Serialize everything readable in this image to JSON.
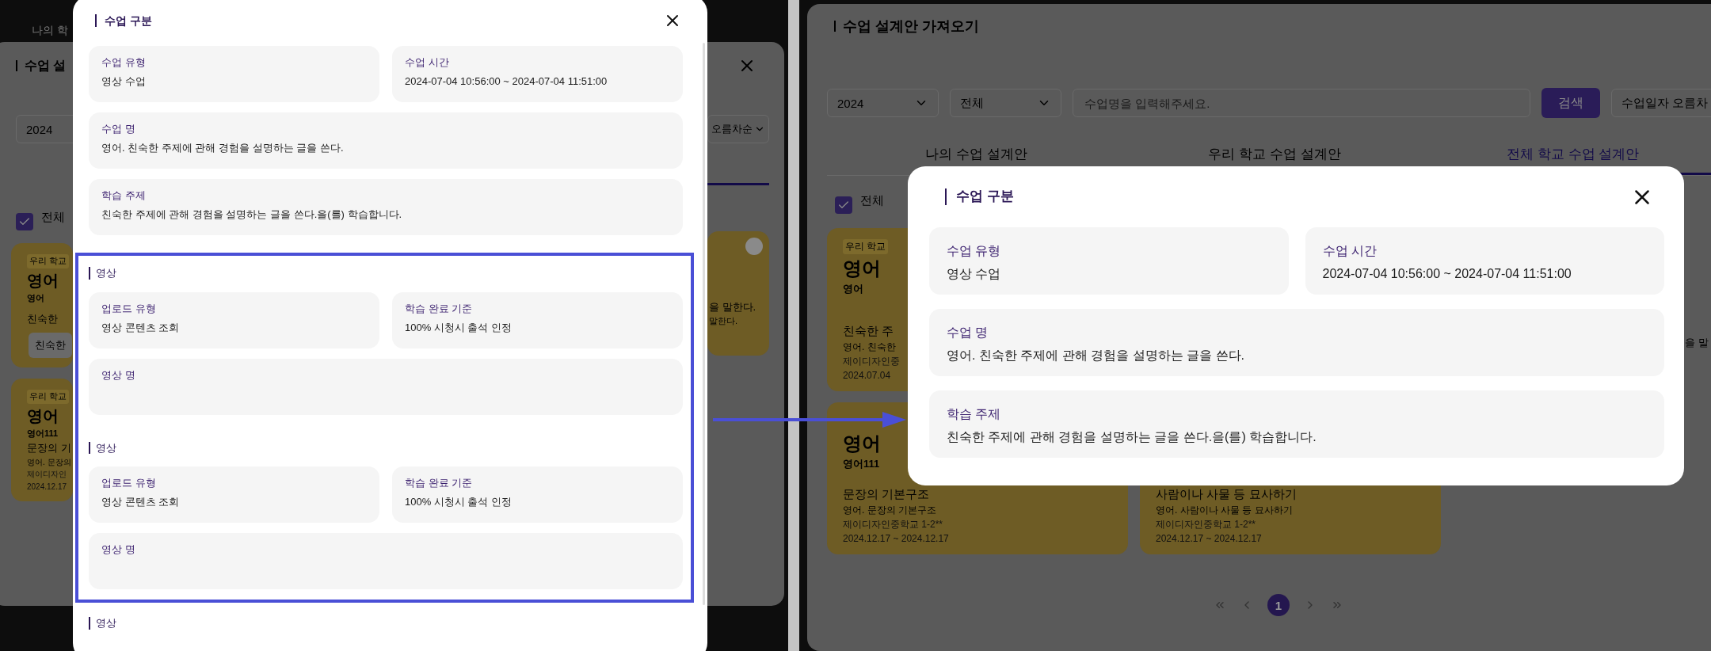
{
  "left_screen": {
    "behind": {
      "top_tab": "나의 학",
      "dialog_title": "수업 설",
      "year_select": "2024",
      "sort_select": "오름차순",
      "select_all": {
        "label": "전체",
        "checked": true
      },
      "cards": [
        {
          "tag": "우리 학교",
          "subject": "영어",
          "course": "영어",
          "lines": [
            "친숙한"
          ],
          "button": "친숙한"
        },
        {
          "tag": "우리 학교",
          "subject": "영어",
          "course": "영어111",
          "lines": [
            "문장의 기",
            "영어. 문장의",
            "제이디자인",
            "2024.12.17"
          ]
        }
      ],
      "side_card": {
        "selected": false,
        "lines": [
          "을 말한다.",
          "말한다."
        ]
      }
    },
    "dialog": {
      "title": "수업 구분",
      "fields": [
        {
          "label": "수업 유형",
          "value": "영상 수업",
          "wide": false
        },
        {
          "label": "수업 시간",
          "value": "2024-07-04 10:56:00 ~ 2024-07-04 11:51:00",
          "wide": false
        },
        {
          "label": "수업 명",
          "value": "영어. 친숙한 주제에 관해 경험을 설명하는 글을 쓴다.",
          "wide": true
        },
        {
          "label": "학습 주제",
          "value": "친숙한 주제에 관해 경험을 설명하는 글을 쓴다.을(를) 학습합니다.",
          "wide": true
        }
      ],
      "sections": [
        {
          "title": "영상",
          "highlighted": true,
          "fields": [
            {
              "label": "업로드 유형",
              "value": "영상 콘텐츠 조회",
              "wide": false
            },
            {
              "label": "학습 완료 기준",
              "value": "100% 시청시 출석 인정",
              "wide": false
            },
            {
              "label": "영상 명",
              "wide": true
            }
          ]
        },
        {
          "title": "영상",
          "highlighted": true,
          "fields": [
            {
              "label": "업로드 유형",
              "value": "영상 콘텐츠 조회",
              "wide": false
            },
            {
              "label": "학습 완료 기준",
              "value": "100% 시청시 출석 인정",
              "wide": false
            },
            {
              "label": "영상 명",
              "wide": true
            }
          ]
        },
        {
          "title": "영상",
          "highlighted": false
        }
      ]
    }
  },
  "right_screen": {
    "behind": {
      "title": "수업 설계안 가져오기",
      "year_select": "2024",
      "type_select": "전체",
      "search": {
        "placeholder": "수업명을 입력해주세요."
      },
      "search_button": "검색",
      "sort_select": "수업일자 오름차",
      "tabs": [
        {
          "label": "나의 수업 설계안",
          "selected": false
        },
        {
          "label": "우리 학교 수업 설계안",
          "selected": false
        },
        {
          "label": "전체 학교 수업 설계안",
          "selected": true
        }
      ],
      "select_all": {
        "label": "전체",
        "checked": true
      },
      "cards": [
        {
          "tag": "우리 학교",
          "subject": "영어",
          "course": "영어",
          "lines": [
            "친숙한 주",
            "영어. 친숙한",
            "제이디자인중",
            "2024.07.04"
          ]
        },
        {
          "subject": "영어",
          "course": "영어111",
          "lines": [
            "문장의 기본구조",
            "영어. 문장의 기본구조",
            "제이디자인중학교 1-2**",
            "2024.12.17 ~ 2024.12.17"
          ]
        },
        {
          "lines": [
            "사람이나 사물 등 묘사하기",
            "영어. 사람이나 사물 등 묘사하기",
            "제이디자인중학교 1-2**",
            "2024.12.17 ~ 2024.12.17"
          ]
        }
      ],
      "edge_text": "을 말",
      "pages": [
        {
          "label": "1",
          "selected": true
        }
      ]
    },
    "dialog": {
      "title": "수업 구분",
      "fields": [
        {
          "label": "수업 유형",
          "value": "영상 수업",
          "wide": false
        },
        {
          "label": "수업 시간",
          "value": "2024-07-04 10:56:00 ~ 2024-07-04 11:51:00",
          "wide": false
        },
        {
          "label": "수업 명",
          "value": "영어. 친숙한 주제에 관해 경험을 설명하는 글을 쓴다.",
          "wide": true
        },
        {
          "label": "학습 주제",
          "value": "친숙한 주제에 관해 경험을 설명하는 글을 쓴다.을(를) 학습합니다.",
          "wide": true
        }
      ]
    }
  }
}
